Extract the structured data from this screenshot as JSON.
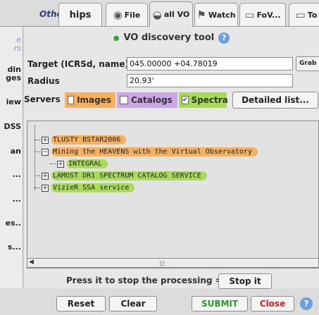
{
  "tabs": {
    "others": "Others",
    "hips": "hips",
    "file": "File",
    "allvo": "all VO",
    "watch": "Watch",
    "fov": "FoV...",
    "to": "To"
  },
  "left": {
    "l1": "e",
    "l2": "rs",
    "l3": "din",
    "l4": "ges",
    "l5": "iew",
    "l6": "DSS",
    "l7": "an",
    "l8": "...",
    "l9": "...",
    "l10": "es..",
    "l11": "s..."
  },
  "panel": {
    "title": "VO discovery tool",
    "target_label": "Target (ICRSd, name)",
    "target_value": "045.00000 +04.78019",
    "grab_label": "Grab c",
    "radius_label": "Radius",
    "radius_value": "20.93'",
    "servers_label": "Servers",
    "images_label": "Images",
    "catalogs_label": "Catalogs",
    "spectra_label": "Spectra",
    "detailed_label": "Detailed list...",
    "stop_text": "Press it to stop the processing =>",
    "stop_label": "Stop it"
  },
  "checkbox_state": {
    "images": false,
    "catalogs": false,
    "spectra": true
  },
  "tree": [
    {
      "label": "TLUSTY BSTAR2006",
      "expand": "+",
      "color": "orange"
    },
    {
      "label": "Mining the HEAVENS with the Virtual Observatory",
      "expand": "−",
      "color": "orange"
    },
    {
      "label": "INTEGRAL",
      "expand": "+",
      "color": "green"
    },
    {
      "label": "LAMOST DR1 SPECTRUM CATALOG SERVICE",
      "expand": "+",
      "color": "green"
    },
    {
      "label": "VizieR SSA service",
      "expand": "+",
      "color": "green"
    }
  ],
  "bottom": {
    "reset": "Reset",
    "clear": "Clear",
    "submit": "SUBMIT",
    "close": "Close",
    "help": "?"
  },
  "colors": {
    "images": "#f7b15c",
    "catalogs": "#cda6e8",
    "spectra": "#a8dc58",
    "submit": "#2a9a2a",
    "close": "#d62020"
  }
}
